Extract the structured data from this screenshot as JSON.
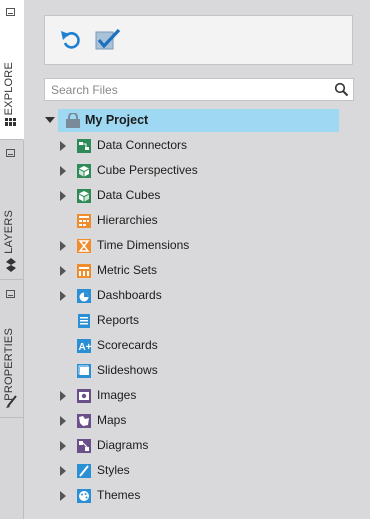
{
  "side_tabs": [
    {
      "label": "EXPLORE",
      "active": true,
      "icon": "books-icon"
    },
    {
      "label": "LAYERS",
      "active": false,
      "icon": "layers-icon"
    },
    {
      "label": "PROPERTIES",
      "active": false,
      "icon": "brush-icon"
    }
  ],
  "toolbar": {
    "refresh_icon": "refresh-icon",
    "check_icon": "checkbox-check-icon"
  },
  "search": {
    "placeholder": "Search Files",
    "value": ""
  },
  "tree": {
    "root": {
      "label": "My Project",
      "expanded": true,
      "icon": "lock-folder-icon"
    },
    "items": [
      {
        "label": "Data Connectors",
        "expandable": true,
        "icon": "data-connector-icon",
        "color": "#2e8b57"
      },
      {
        "label": "Cube Perspectives",
        "expandable": true,
        "icon": "cube-perspective-icon",
        "color": "#2e8b57"
      },
      {
        "label": "Data Cubes",
        "expandable": true,
        "icon": "data-cube-icon",
        "color": "#2e8b57"
      },
      {
        "label": "Hierarchies",
        "expandable": false,
        "icon": "hierarchy-icon",
        "color": "#f08c2c"
      },
      {
        "label": "Time Dimensions",
        "expandable": true,
        "icon": "time-dimension-icon",
        "color": "#f08c2c"
      },
      {
        "label": "Metric Sets",
        "expandable": true,
        "icon": "metric-set-icon",
        "color": "#f08c2c"
      },
      {
        "label": "Dashboards",
        "expandable": true,
        "icon": "dashboard-icon",
        "color": "#2b8fd6"
      },
      {
        "label": "Reports",
        "expandable": false,
        "icon": "report-icon",
        "color": "#2b8fd6"
      },
      {
        "label": "Scorecards",
        "expandable": false,
        "icon": "scorecard-icon",
        "color": "#2b8fd6"
      },
      {
        "label": "Slideshows",
        "expandable": false,
        "icon": "slideshow-icon",
        "color": "#2b8fd6"
      },
      {
        "label": "Images",
        "expandable": true,
        "icon": "image-icon",
        "color": "#6b4f8a"
      },
      {
        "label": "Maps",
        "expandable": true,
        "icon": "map-icon",
        "color": "#6b4f8a"
      },
      {
        "label": "Diagrams",
        "expandable": true,
        "icon": "diagram-icon",
        "color": "#6b4f8a"
      },
      {
        "label": "Styles",
        "expandable": true,
        "icon": "style-icon",
        "color": "#2b8fd6"
      },
      {
        "label": "Themes",
        "expandable": true,
        "icon": "theme-icon",
        "color": "#2b8fd6"
      }
    ]
  },
  "colors": {
    "selection": "#9ed8f2",
    "panel_bg": "#d9d9db",
    "accent_blue": "#2b8fd6"
  }
}
